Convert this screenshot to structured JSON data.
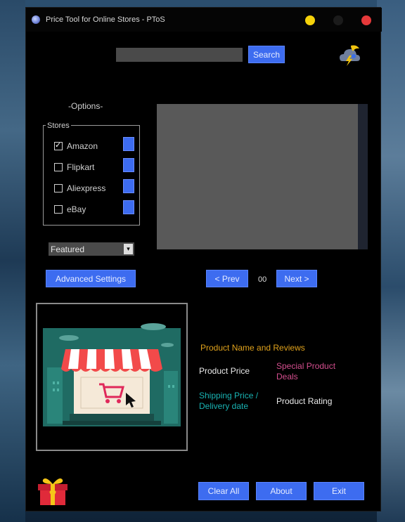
{
  "window": {
    "title": "Price Tool for Online Stores - PToS"
  },
  "search": {
    "value": "",
    "placeholder": "",
    "button_label": "Search"
  },
  "options": {
    "heading": "-Options-",
    "stores_legend": "Stores",
    "stores": [
      {
        "name": "Amazon",
        "checked": true,
        "color": "#3d6cf0"
      },
      {
        "name": "Flipkart",
        "checked": false,
        "color": "#3d6cf0"
      },
      {
        "name": "Aliexpress",
        "checked": false,
        "color": "#3d6cf0"
      },
      {
        "name": "eBay",
        "checked": false,
        "color": "#3d6cf0"
      }
    ],
    "sort_selected": "Featured",
    "advanced_label": "Advanced Settings"
  },
  "pager": {
    "prev_label": "< Prev",
    "page": "00",
    "next_label": "Next >"
  },
  "details": {
    "product_name": "Product Name and Reviews",
    "product_price": "Product Price",
    "special_deals": "Special Product Deals",
    "shipping": "Shipping Price / Delivery date",
    "rating": "Product Rating"
  },
  "footer": {
    "clear_label": "Clear All",
    "about_label": "About",
    "exit_label": "Exit"
  },
  "colors": {
    "accent": "#3d6cf0",
    "name_color": "#e0a21c",
    "deal_color": "#d44e8e",
    "ship_color": "#19b3b3"
  },
  "icons": [
    "app-icon",
    "weather-icon",
    "shop-icon",
    "gift-icon"
  ]
}
